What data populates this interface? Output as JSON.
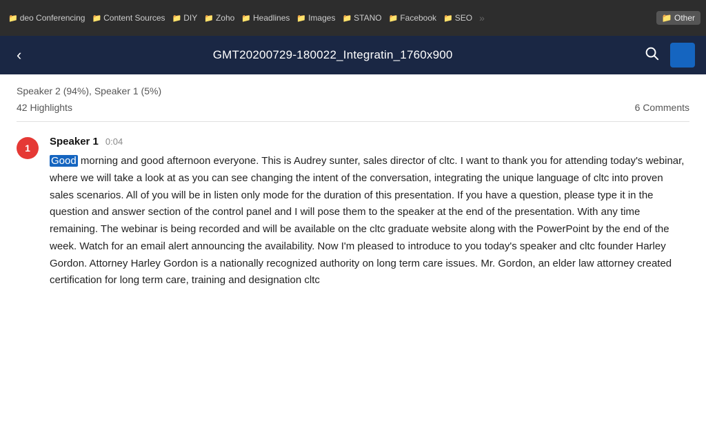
{
  "browser": {
    "bar_bg": "#2d2d2d",
    "ext_badge": "0.29",
    "bookmarks": [
      {
        "label": "deo Conferencing",
        "icon": "📁"
      },
      {
        "label": "Content Sources",
        "icon": "📁"
      },
      {
        "label": "DIY",
        "icon": "📁"
      },
      {
        "label": "Zoho",
        "icon": "📁"
      },
      {
        "label": "Headlines",
        "icon": "📁"
      },
      {
        "label": "Images",
        "icon": "📁"
      },
      {
        "label": "STANO",
        "icon": "📁"
      },
      {
        "label": "Facebook",
        "icon": "📁"
      },
      {
        "label": "SEO",
        "icon": "📁"
      }
    ],
    "other_label": "Other"
  },
  "header": {
    "title": "GMT20200729-180022_Integratin_1760x900",
    "back_label": "‹",
    "search_icon": "🔍"
  },
  "stats": {
    "speakers": "Speaker 2 (94%), Speaker 1 (5%)",
    "highlights": "42 Highlights",
    "comments": "6 Comments"
  },
  "transcript": {
    "speaker_number": "1",
    "speaker_name": "Speaker 1",
    "speaker_time": "0:04",
    "highlight_word": "Good",
    "body": " morning and good afternoon everyone. This is Audrey sunter, sales director of cltc. I want to thank you for attending today's webinar, where we will take a look at as you can see changing the intent of the conversation, integrating the unique language of cltc into proven sales scenarios. All of you will be in listen only mode for the duration of this presentation. If you have a question, please type it in the question and answer section of the control panel and I will pose them to the speaker at the end of the presentation. With any time remaining. The webinar is being recorded and will be available on the cltc graduate website along with the PowerPoint by the end of the week. Watch for an email alert announcing the availability. Now I'm pleased to introduce to you today's speaker and cltc founder Harley Gordon. Attorney Harley Gordon is a nationally recognized authority on long term care issues. Mr. Gordon, an elder law attorney created certification for long term care, training and designation cltc"
  }
}
